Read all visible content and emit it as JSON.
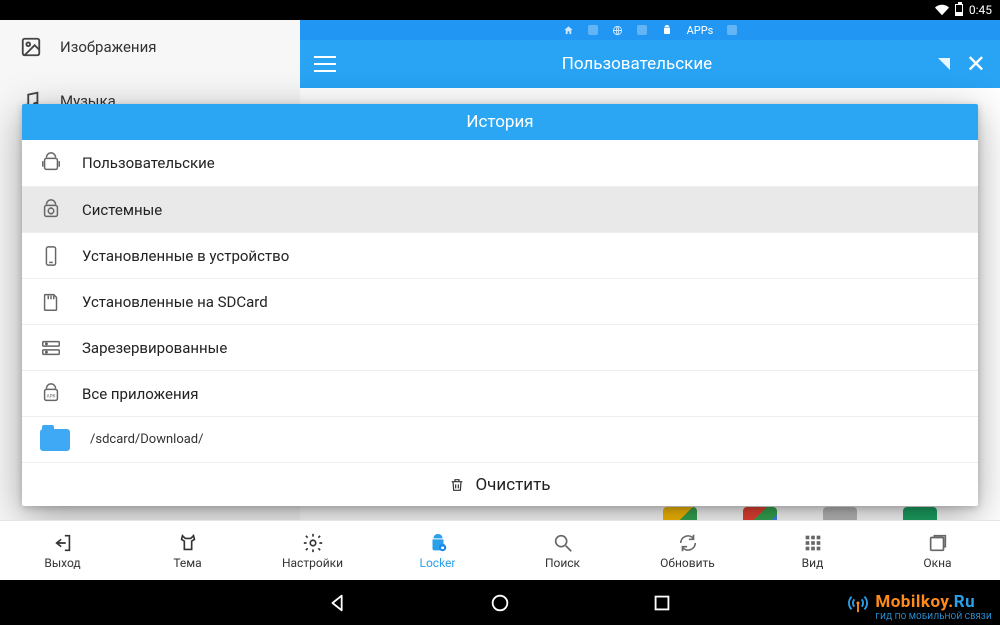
{
  "statusbar": {
    "time": "0:45"
  },
  "sidebar": {
    "items": [
      {
        "label": "Изображения"
      },
      {
        "label": "Музыка"
      }
    ]
  },
  "crumb": {
    "label": "APPs"
  },
  "appbar": {
    "title": "Пользовательские"
  },
  "dialog": {
    "title": "История",
    "items": [
      {
        "label": "Пользовательские"
      },
      {
        "label": "Системные"
      },
      {
        "label": "Установленные в устройство"
      },
      {
        "label": "Установленные на SDCard"
      },
      {
        "label": "Зарезервированные"
      },
      {
        "label": "Все приложения"
      }
    ],
    "path": "/sdcard/Download/",
    "clear": "Очистить"
  },
  "toolbar": {
    "items": [
      {
        "label": "Выход"
      },
      {
        "label": "Тема"
      },
      {
        "label": "Настройки"
      },
      {
        "label": "Locker"
      },
      {
        "label": "Поиск"
      },
      {
        "label": "Обновить"
      },
      {
        "label": "Вид"
      },
      {
        "label": "Окна"
      }
    ]
  },
  "brand": {
    "name1": "Mobilkoy.",
    "name2": "Ru",
    "tag": "ГИД ПО МОБИЛЬНОЙ СВЯЗИ"
  }
}
